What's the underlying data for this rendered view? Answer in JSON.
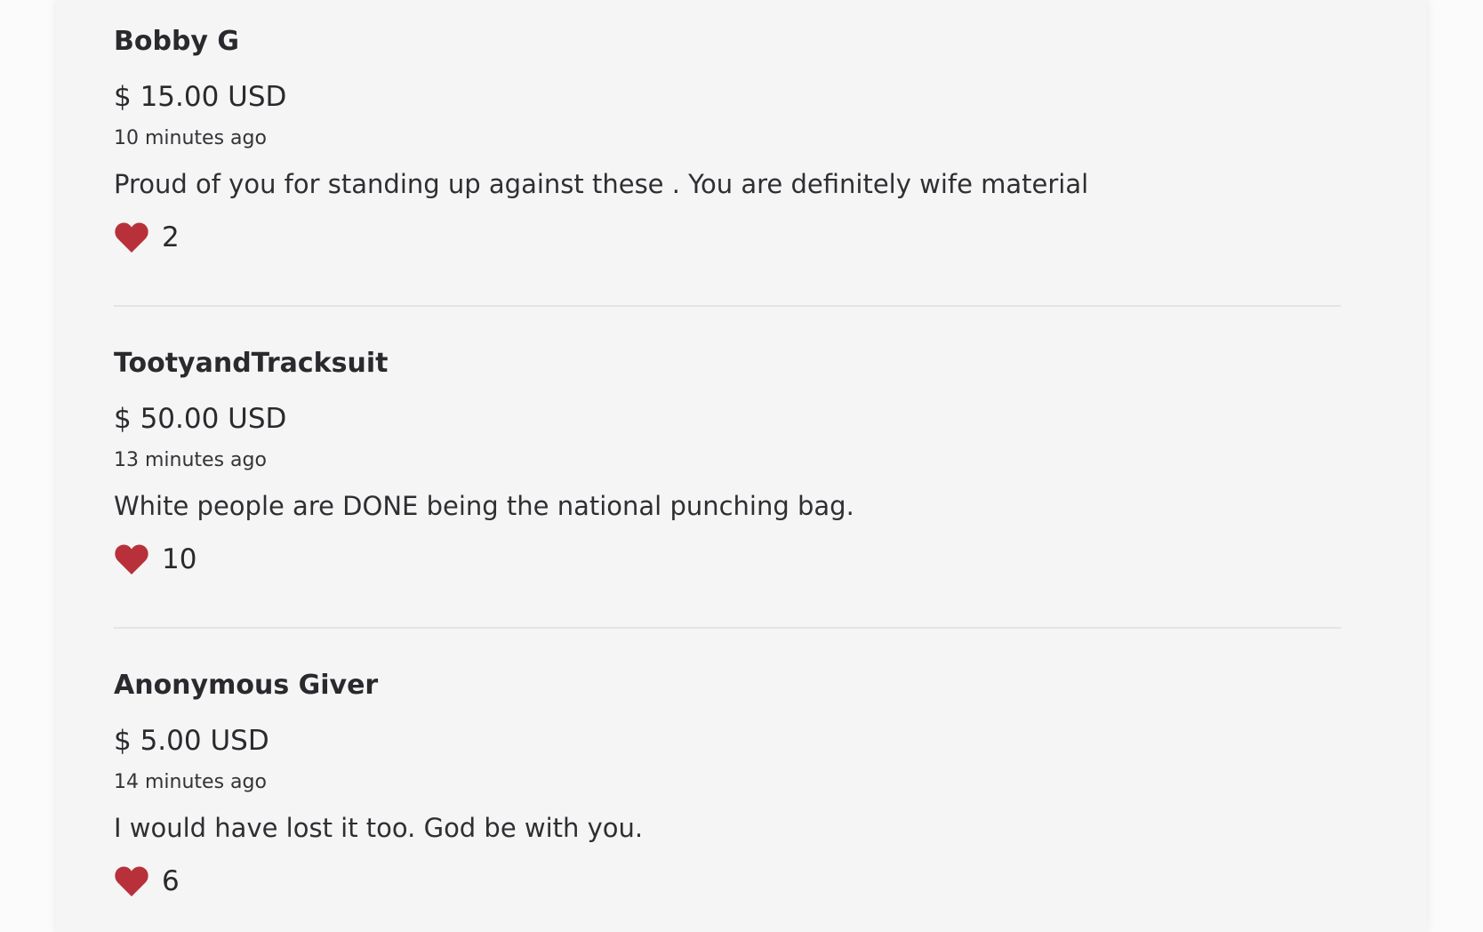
{
  "donations": [
    {
      "name": "Bobby G",
      "amount": "$ 15.00 USD",
      "time": "10 minutes ago",
      "message": "Proud of you for standing up against these . You are definitely wife material",
      "likes": "2"
    },
    {
      "name": "TootyandTracksuit",
      "amount": "$ 50.00 USD",
      "time": "13 minutes ago",
      "message": "White people are DONE being the national punching bag.",
      "likes": "10"
    },
    {
      "name": "Anonymous Giver",
      "amount": "$ 5.00 USD",
      "time": "14 minutes ago",
      "message": "I would have lost it too. God be with you.",
      "likes": "6"
    }
  ],
  "colors": {
    "heart": "#b8313a",
    "panel_background": "#f5f5f5",
    "page_background": "#fbfbfb",
    "divider": "#e4e4e4",
    "text": "#2a2a2e"
  },
  "icons": {
    "like": "heart-icon"
  }
}
